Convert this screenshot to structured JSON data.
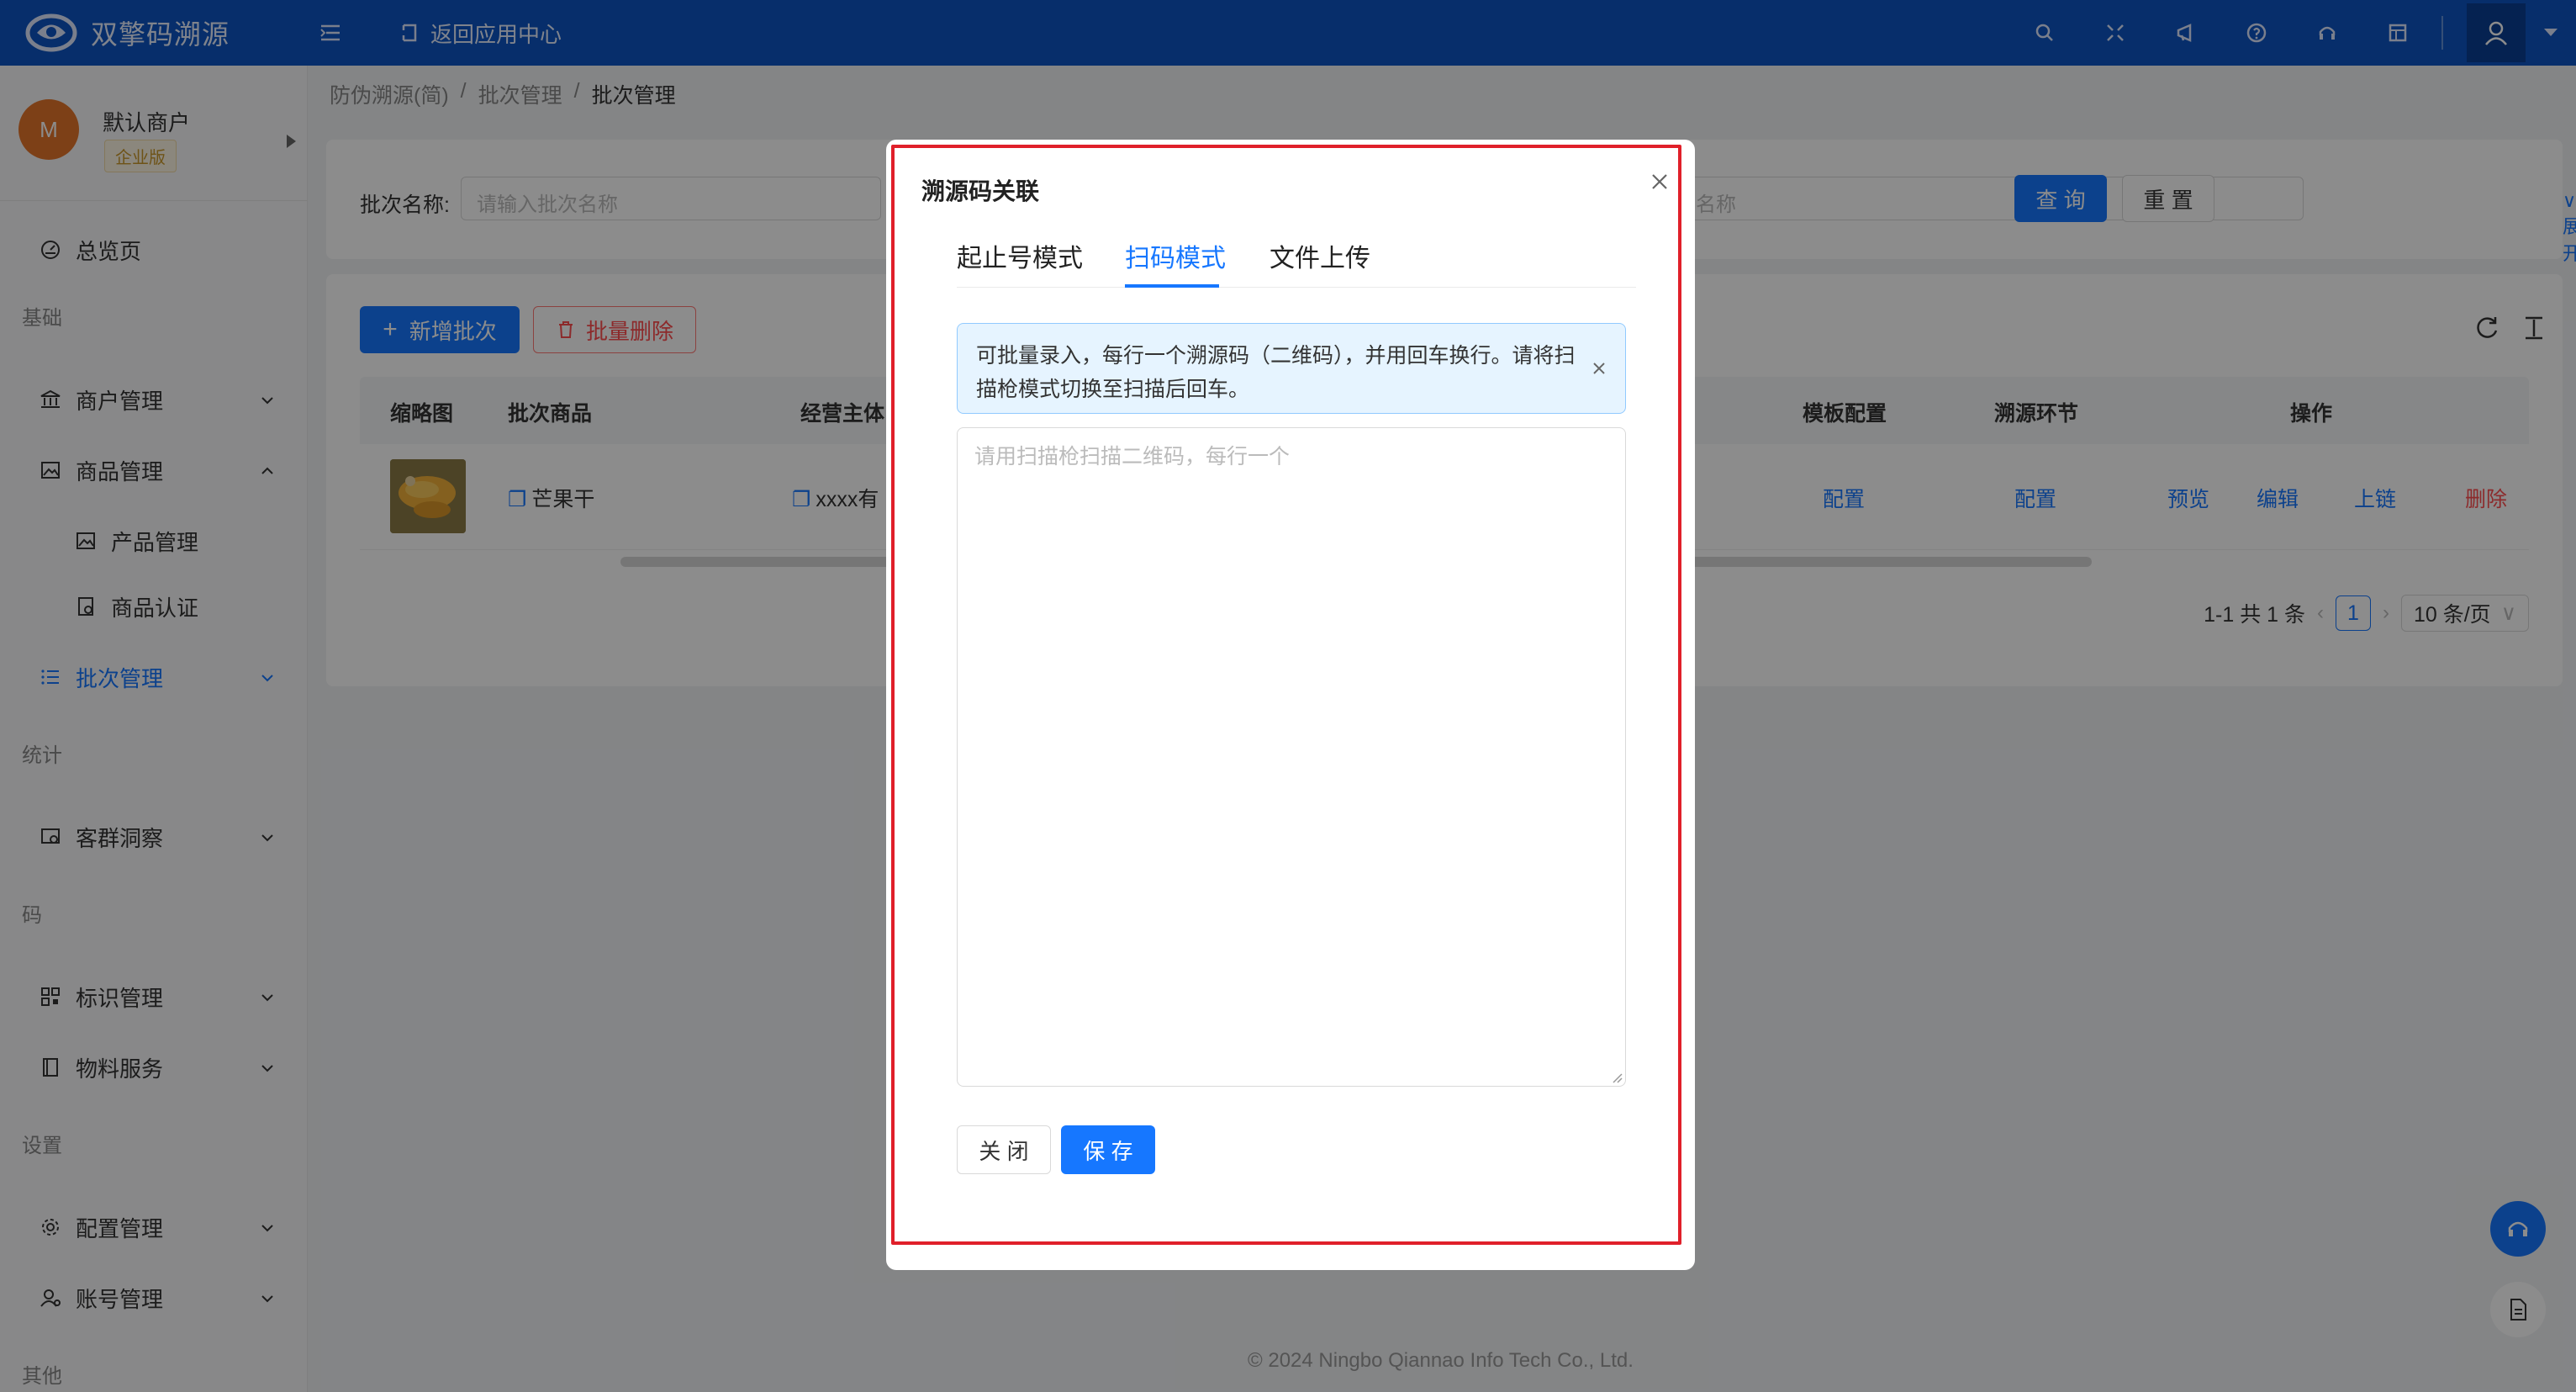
{
  "app": {
    "brand": "双擎码溯源",
    "back_label": "返回应用中心"
  },
  "topbar": {
    "icons": [
      "search-icon",
      "fullscreen-icon",
      "notice-icon",
      "help-icon",
      "headset-icon",
      "layout-icon"
    ],
    "user_icon": "user-icon"
  },
  "merchant": {
    "avatar_letter": "M",
    "name": "默认商户",
    "badge": "企业版"
  },
  "sidebar": {
    "overview": "总览页",
    "group_basic": "基础",
    "merchant_mgmt": "商户管理",
    "goods_mgmt": "商品管理",
    "product_mgmt": "产品管理",
    "goods_cert": "商品认证",
    "batch_mgmt": "批次管理",
    "group_stats": "统计",
    "customer_insight": "客群洞察",
    "group_code": "码",
    "label_mgmt": "标识管理",
    "material_service": "物料服务",
    "group_settings": "设置",
    "config_mgmt": "配置管理",
    "account_mgmt": "账号管理",
    "group_other": "其他"
  },
  "breadcrumb": [
    "防伪溯源(简)",
    "批次管理",
    "批次管理"
  ],
  "search": {
    "label": "批次名称:",
    "placeholder": "请输入批次名称",
    "hidden_placeholder_tail": "名称",
    "query": "查 询",
    "reset": "重 置",
    "expand": "展开"
  },
  "toolbar": {
    "add": "新增批次",
    "batch_delete": "批量删除"
  },
  "table": {
    "headers": {
      "thumb": "缩略图",
      "product": "批次商品",
      "entity": "经营主体",
      "template": "模板配置",
      "trace": "溯源环节",
      "actions": "操作"
    },
    "rows": [
      {
        "product": "芒果干",
        "entity": "xxxx有",
        "template": "配置",
        "trace": "配置",
        "preview": "预览",
        "edit": "编辑",
        "chain": "上链",
        "delete": "删除"
      }
    ]
  },
  "pagination": {
    "summary": "1-1 共 1 条",
    "current": "1",
    "page_size": "10 条/页"
  },
  "footer": "© 2024 Ningbo Qiannao Info Tech Co., Ltd.",
  "modal": {
    "title": "溯源码关联",
    "tabs": [
      "起止号模式",
      "扫码模式",
      "文件上传"
    ],
    "active_tab": "扫码模式",
    "alert": "可批量录入，每行一个溯源码（二维码），并用回车换行。请将扫描枪模式切换至扫描后回车。",
    "textarea_placeholder": "请用扫描枪扫描二维码，每行一个",
    "close": "关 闭",
    "save": "保 存"
  },
  "colors": {
    "primary": "#1677ff",
    "topbar": "#0d55c4",
    "danger": "#ff4d4f",
    "highlight": "#e0202a"
  }
}
